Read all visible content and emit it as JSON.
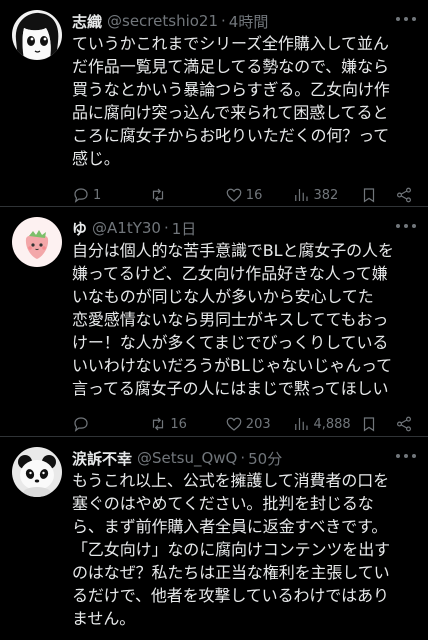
{
  "tweets": [
    {
      "name": "志織",
      "handle": "@secretshio21",
      "time": "4時間",
      "avatar_icon": "anime-girl-avatar",
      "text": [
        "ていうかこれまでシリーズ全作購入して並ん",
        "だ作品一覧見て満足してる勢なので、嫌なら",
        "買うなとかいう暴論つらすぎる。乙女向け作",
        "品に腐向け突っ込んで来られて困惑してると",
        "ころに腐女子からお叱りいただくの何？って",
        "感じ。"
      ],
      "stats": {
        "replies": "1",
        "retweets": "",
        "likes": "16",
        "views": "382"
      }
    },
    {
      "name": "ゆ",
      "handle": "@A1tY30",
      "time": "1日",
      "avatar_icon": "strawberry-avatar",
      "text": [
        "自分は個人的な苦手意識でBLと腐女子の人を",
        "嫌ってるけど、乙女向け作品好きな人って嫌",
        "いなものが同じな人が多いから安心してた",
        "恋愛感情ないなら男同士がキスしててもおっ",
        "けー！な人が多くてまじでびっくりしている",
        "いいわけないだろうがBLじゃないじゃんって",
        "言ってる腐女子の人にはまじで黙ってほしい"
      ],
      "stats": {
        "replies": "",
        "retweets": "16",
        "likes": "203",
        "views": "4,888"
      }
    },
    {
      "name": "涙訴不幸",
      "handle": "@Setsu_QwQ",
      "time": "50分",
      "avatar_icon": "panda-avatar",
      "text": [
        "もうこれ以上、公式を擁護して消費者の口を",
        "塞ぐのはやめてください。批判を封じるな",
        "ら、まず前作購入者全員に返金すべきです。",
        "「乙女向け」なのに腐向けコンテンツを出す",
        "のはなぜ？私たちは正当な権利を主張してい",
        "るだけで、他者を攻撃しているわけではあり",
        "ません。"
      ],
      "stats": null
    }
  ],
  "colors": {
    "background": "#000000",
    "text": "#e7e9ea",
    "muted": "#71767b",
    "divider": "#2f3336"
  }
}
